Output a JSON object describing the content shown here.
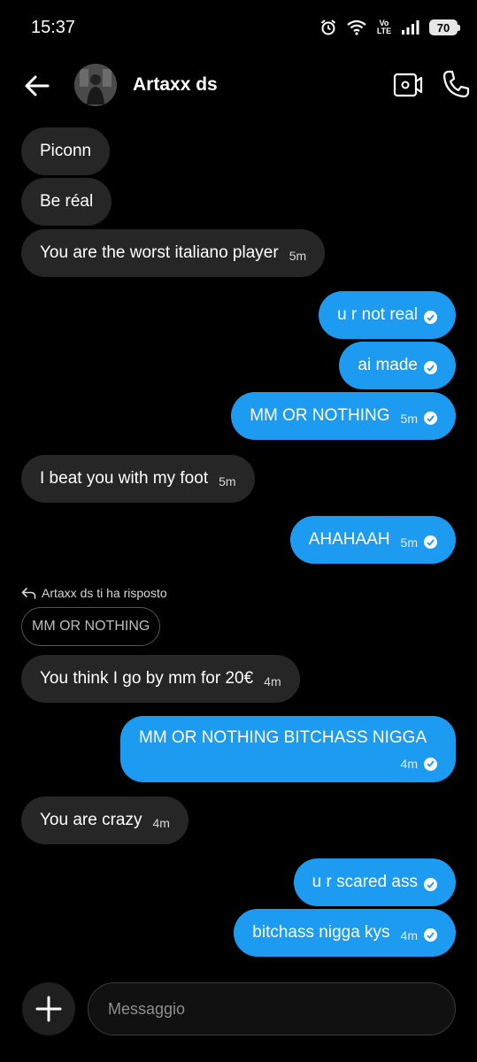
{
  "status_bar": {
    "time": "15:37",
    "network": "Vo LTE",
    "battery": "70"
  },
  "header": {
    "contact_name": "Artaxx ds"
  },
  "messages": [
    {
      "dir": "in",
      "text": "Piconn",
      "time": ""
    },
    {
      "dir": "in",
      "text": "Be réal",
      "time": ""
    },
    {
      "dir": "in",
      "text": "You are the worst italiano player",
      "time": "5m"
    },
    {
      "dir": "out",
      "text": "u r not real",
      "time": ""
    },
    {
      "dir": "out",
      "text": "ai made",
      "time": ""
    },
    {
      "dir": "out",
      "text": "MM OR NOTHING",
      "time": "5m"
    },
    {
      "dir": "in",
      "text": "I beat you with my foot",
      "time": "5m"
    },
    {
      "dir": "out",
      "text": "AHAHAAH",
      "time": "5m"
    },
    {
      "dir": "in",
      "text": "You think I go by mm for 20€",
      "time": "4m"
    },
    {
      "dir": "out",
      "text": "MM OR NOTHING BITCHASS NIGGA",
      "time": "4m"
    },
    {
      "dir": "in",
      "text": "You are crazy",
      "time": "4m"
    },
    {
      "dir": "out",
      "text": "u r scared ass",
      "time": ""
    },
    {
      "dir": "out",
      "text": "bitchass nigga kys",
      "time": "4m"
    }
  ],
  "reply": {
    "indicator": "Artaxx ds ti ha risposto",
    "quoted_text": "MM OR NOTHING"
  },
  "composer": {
    "placeholder": "Messaggio"
  },
  "colors": {
    "outgoing": "#1d9bf0",
    "incoming": "#262626",
    "background": "#000000"
  }
}
